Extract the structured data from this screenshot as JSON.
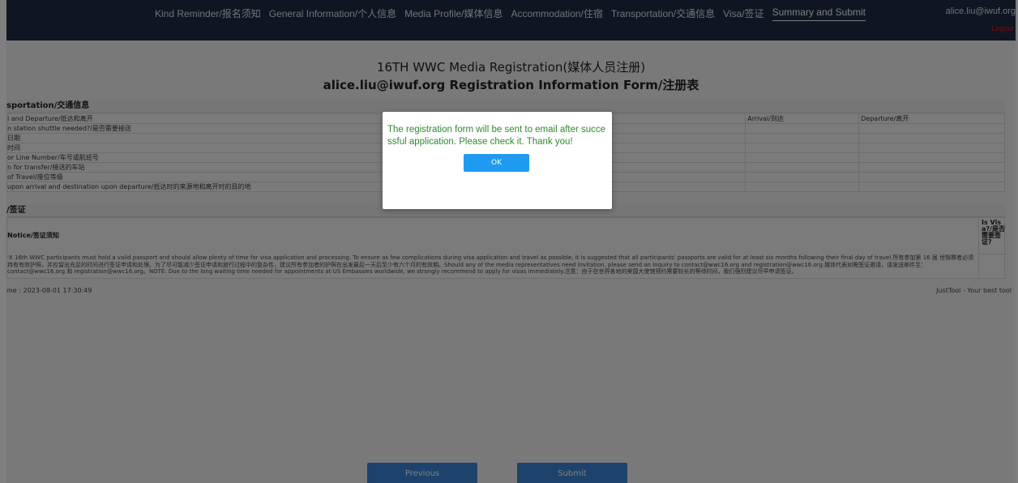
{
  "nav": {
    "items": [
      "Kind Reminder/报名须知",
      "General Information/个人信息",
      "Media Profile/媒体信息",
      "Accommodation/住宿",
      "Transportation/交通信息",
      "Visa/签证",
      "Summary and Submit"
    ],
    "user_email": "alice.liu@iwuf.org",
    "logout_label": "Logout"
  },
  "header": {
    "title": "16TH WWC Media Registration(媒体人员注册)",
    "subtitle": "alice.liu@iwuf.org Registration Information Form/注册表"
  },
  "transportation": {
    "section_title": "sportation/交通信息",
    "header_row": {
      "label": "l and Departure/抵达和离开",
      "arrival": "Arrival/到达",
      "departure": "Departure/离开"
    },
    "rows": [
      "n station shuttle needed?/是否需要接送",
      "日期",
      "时间",
      "or Line Number/车号或航班号",
      "n for transfer/接送的车站",
      "of Travel/座位等级",
      "upon arrival and destination upon departure/抵达时的来源地和离开时的目的地"
    ]
  },
  "visa": {
    "section_title": "/签证",
    "notice_label": "Notice/签证须知",
    "is_visa_label": "Is Visa?/是否需要签证?",
    "notice_text": "'X 16th WWC participants must hold a valid passport and should allow plenty of time for visa application and processing. To ensure as few complications during visa application and travel as possible, it is suggested that all participants' passports are valid for at least six months following their final day of travel.所有参加第 16 届 世锦赛者必须持有有效护照，并应留出充足的时间进行签证申请和处理。为了尽可能减少签证申请和旅行过程中的复杂性，建议所有参加者的护照在出发最后一天后至少有六个月的有效期。Should any of the media representatives need invitation, please send an inquiry to contact@wwc16.org and registration@wwc16.org.媒体代表如需签证邀请，请发送邮件至：contact@wwc16.org 和 registration@wwc16.org。NOTE: Due to the long waiting time needed for appointments at US Embassies worldwide, we strongly recommend to apply for visas immediately.注意：由于在世界各地的美国大使馆预约需要较长的等待时间，我们强烈建议尽早申请签证。"
  },
  "footer": {
    "timestamp": "me : 2023-08-01 17:30:49",
    "justtool": "JustTool - Your best tool"
  },
  "buttons": {
    "previous": "Previous",
    "submit": "Submit"
  },
  "modal": {
    "message": "The registration form will be sent to email after successful application. Please check it. Thank you!",
    "ok_label": "OK"
  },
  "colors": {
    "navbar": "#1f2a44",
    "accent": "#3a86d9",
    "modal_text": "#2f8a2f",
    "logout": "#e02020"
  }
}
